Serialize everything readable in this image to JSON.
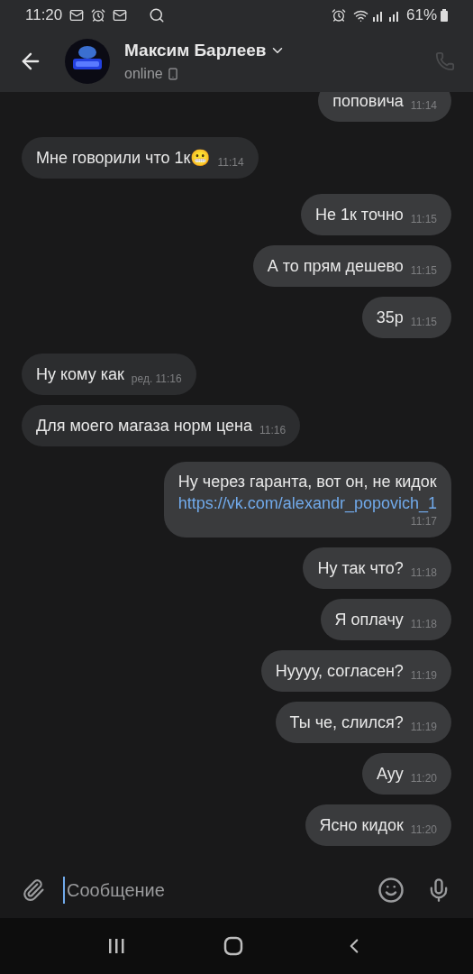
{
  "status_bar": {
    "time": "11:20",
    "battery": "61%"
  },
  "header": {
    "name": "Максим Барлеев",
    "status": "online"
  },
  "messages": [
    {
      "kind": "out",
      "text": "поповича",
      "time": "11:14"
    },
    {
      "kind": "in",
      "text": "Мне говорили что 1к😬",
      "time": "11:14"
    },
    {
      "kind": "out",
      "text": "Не 1к точно",
      "time": "11:15"
    },
    {
      "kind": "out",
      "text": "А то прям дешево",
      "time": "11:15"
    },
    {
      "kind": "out",
      "text": "35р",
      "time": "11:15"
    },
    {
      "kind": "in",
      "text": "Ну кому как",
      "time": "ред. 11:16"
    },
    {
      "kind": "in",
      "text": "Для моего магаза норм цена",
      "time": "11:16"
    },
    {
      "kind": "out",
      "text": "Ну через гаранта, вот он, не кидок",
      "link": "https://vk.com/alexandr_popovich_1",
      "time": "11:17"
    },
    {
      "kind": "out",
      "text": "Ну так что?",
      "time": "11:18"
    },
    {
      "kind": "out",
      "text": "Я оплачу",
      "time": "11:18"
    },
    {
      "kind": "out",
      "text": "Нуууу, согласен?",
      "time": "11:19"
    },
    {
      "kind": "out",
      "text": "Ты че, слился?",
      "time": "11:19"
    },
    {
      "kind": "out",
      "text": "Ауу",
      "time": "11:20"
    },
    {
      "kind": "out",
      "text": "Ясно кидок",
      "time": "11:20"
    }
  ],
  "composer": {
    "placeholder": "Сообщение"
  }
}
